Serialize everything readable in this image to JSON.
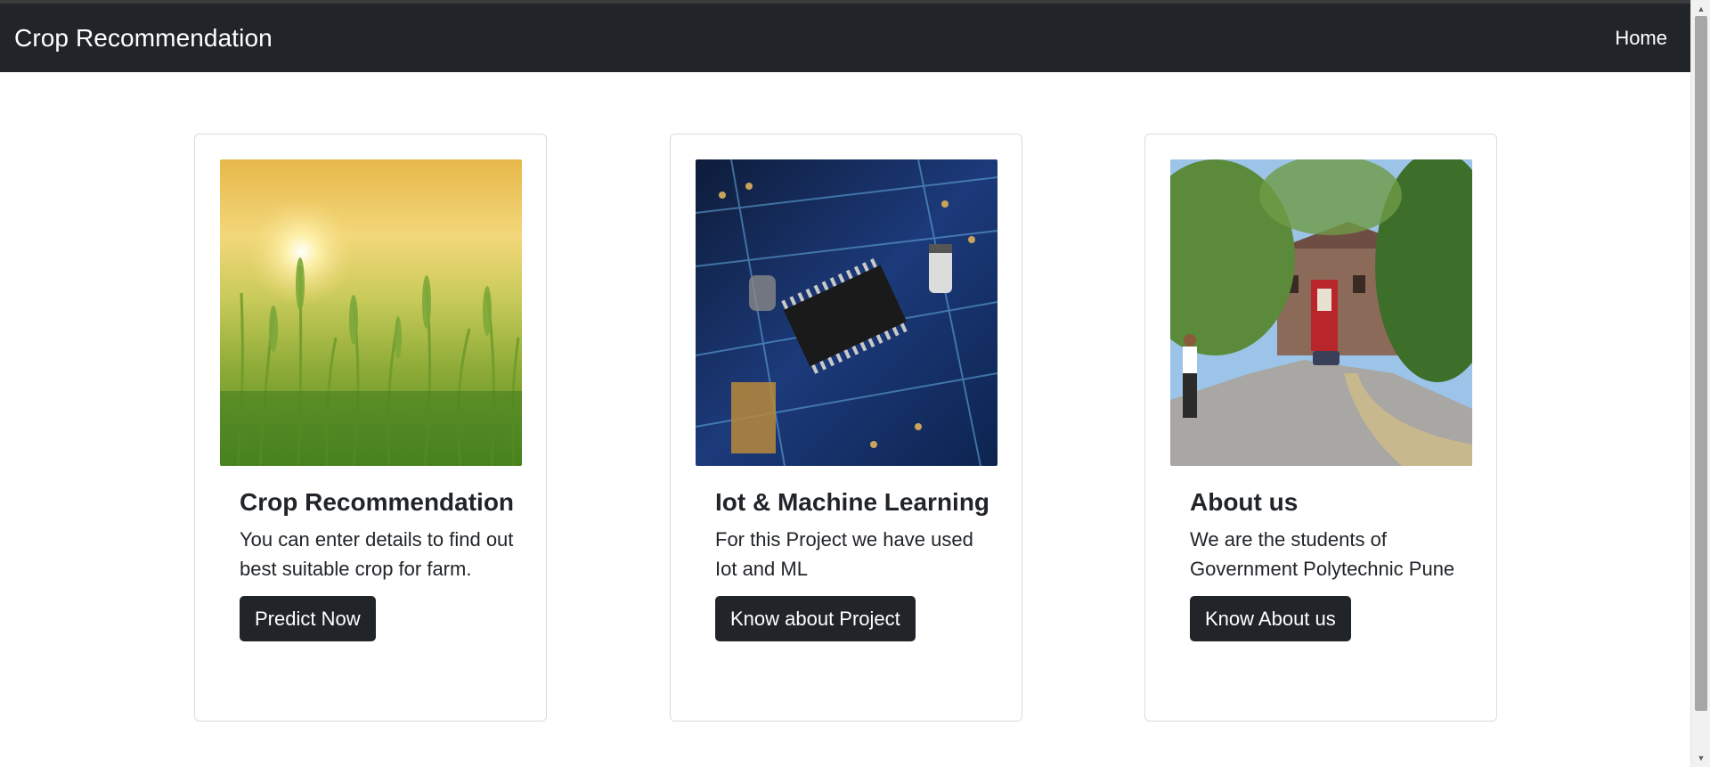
{
  "navbar": {
    "brand": "Crop Recommendation",
    "home_link": "Home"
  },
  "cards": [
    {
      "title": "Crop Recommendation",
      "text": "You can enter details to find out best suitable crop for farm.",
      "button": "Predict Now",
      "image": "wheat-field-sunset-photo"
    },
    {
      "title": "Iot & Machine Learning",
      "text": "For this Project we have used Iot and ML",
      "button": "Know about Project",
      "image": "circuit-board-photo"
    },
    {
      "title": "About us",
      "text": "We are the students of Government Polytechnic Pune",
      "button": "Know About us",
      "image": "college-campus-photo"
    }
  ],
  "colors": {
    "navbar_bg": "#212529",
    "button_bg": "#212529",
    "text": "#212529"
  }
}
